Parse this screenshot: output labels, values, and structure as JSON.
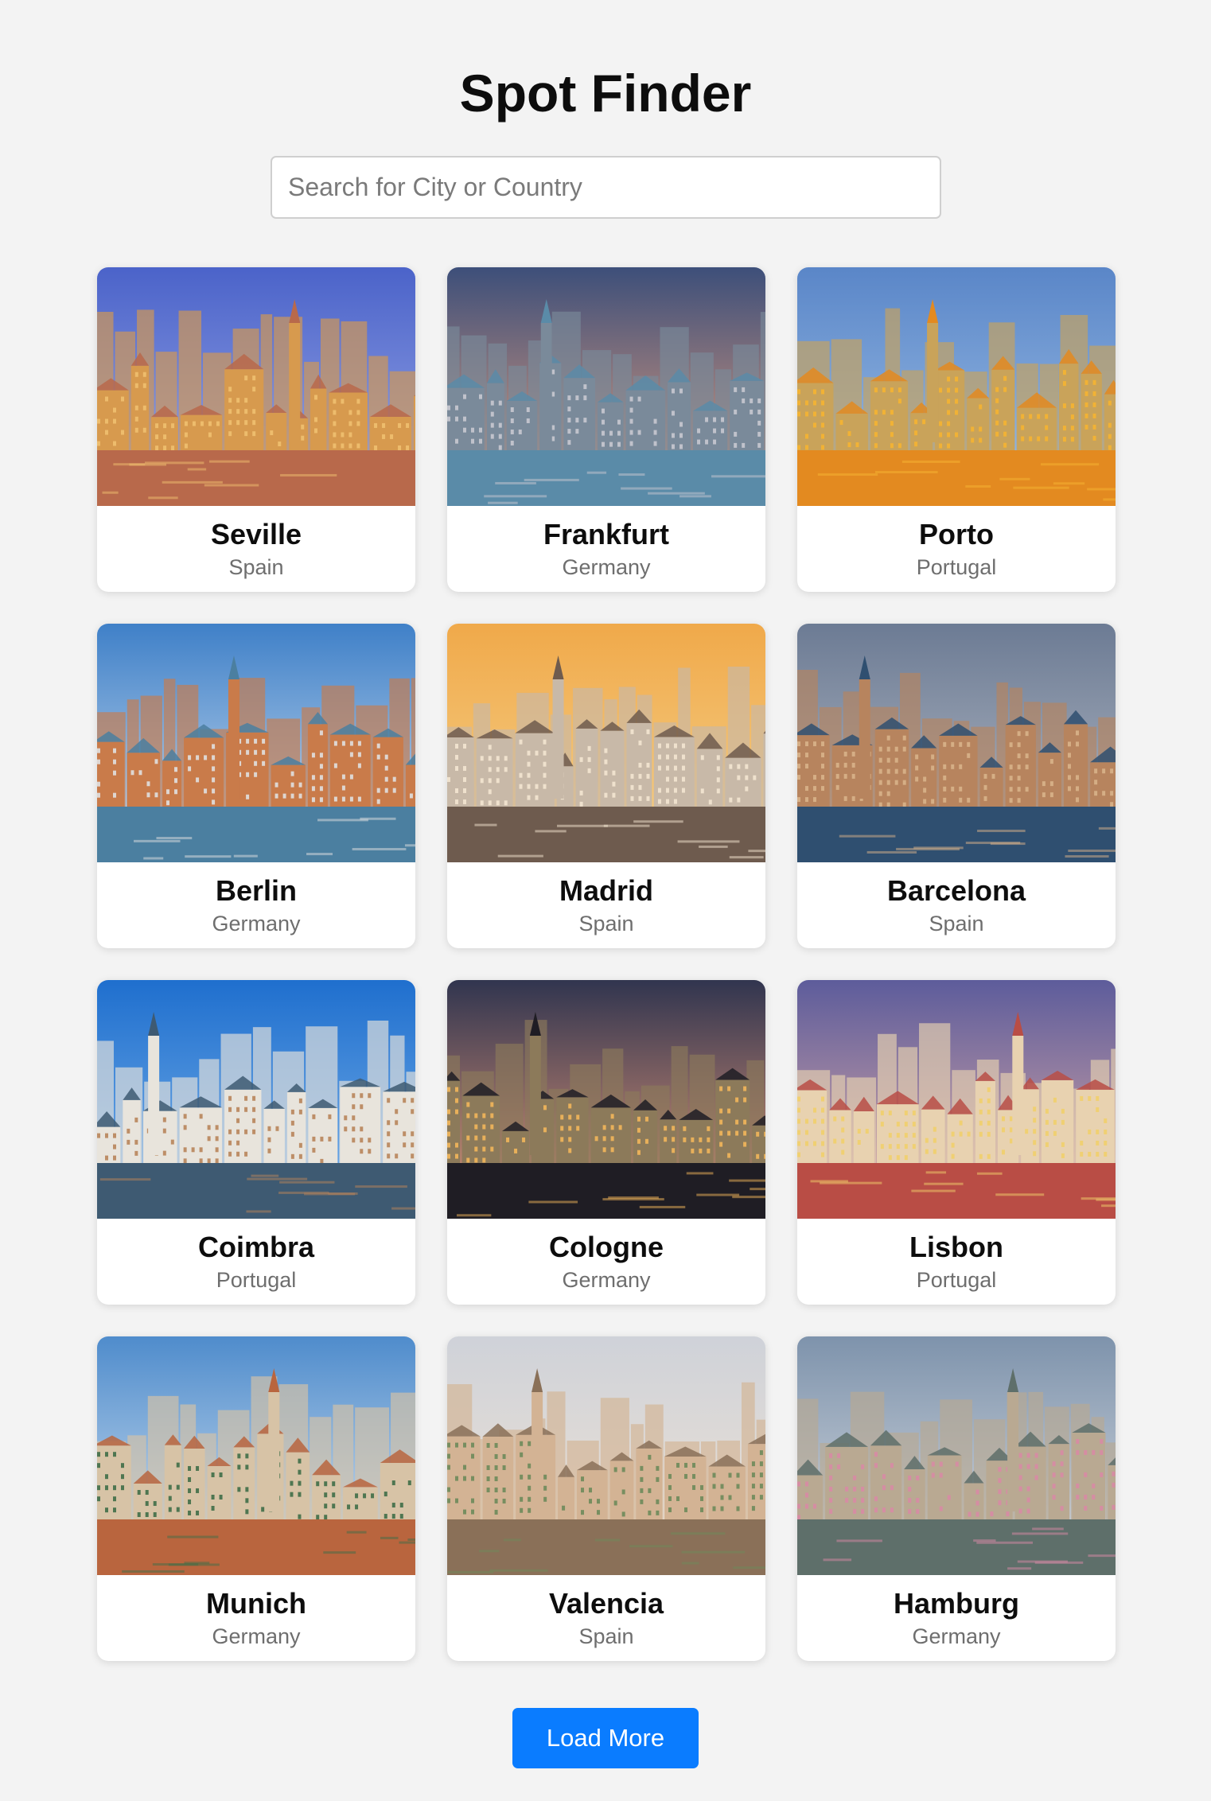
{
  "header": {
    "title": "Spot Finder"
  },
  "search": {
    "placeholder": "Search for City or Country",
    "value": ""
  },
  "cities": [
    {
      "name": "Seville",
      "country": "Spain",
      "palette": {
        "sky_top": "#4b63c9",
        "sky_bottom": "#9aa9e8",
        "ground": "#b8694b",
        "buildings": "#d79a4e",
        "accent": "#f0c070"
      }
    },
    {
      "name": "Frankfurt",
      "country": "Germany",
      "palette": {
        "sky_top": "#3d4f7a",
        "sky_bottom": "#e8a27e",
        "ground": "#5a8ba8",
        "buildings": "#7a8a9a",
        "accent": "#c8c8d0"
      }
    },
    {
      "name": "Porto",
      "country": "Portugal",
      "palette": {
        "sky_top": "#5a86c8",
        "sky_bottom": "#9ec0e6",
        "ground": "#e38a20",
        "buildings": "#c9a35a",
        "accent": "#f5b431"
      }
    },
    {
      "name": "Berlin",
      "country": "Germany",
      "palette": {
        "sky_top": "#3f80c8",
        "sky_bottom": "#cfe0f0",
        "ground": "#4b7fa0",
        "buildings": "#c97b4a",
        "accent": "#e0e0e0"
      }
    },
    {
      "name": "Madrid",
      "country": "Spain",
      "palette": {
        "sky_top": "#f0a94a",
        "sky_bottom": "#f6d28c",
        "ground": "#6e5b4e",
        "buildings": "#c8b9a8",
        "accent": "#f3e5d0"
      }
    },
    {
      "name": "Barcelona",
      "country": "Spain",
      "palette": {
        "sky_top": "#6c7b94",
        "sky_bottom": "#b6bcc6",
        "ground": "#2f4f70",
        "buildings": "#b7845e",
        "accent": "#d8b28a"
      }
    },
    {
      "name": "Coimbra",
      "country": "Portugal",
      "palette": {
        "sky_top": "#1f6fce",
        "sky_bottom": "#7bb3ea",
        "ground": "#3e5a72",
        "buildings": "#e8e4dc",
        "accent": "#b8845a"
      }
    },
    {
      "name": "Cologne",
      "country": "Germany",
      "palette": {
        "sky_top": "#31354f",
        "sky_bottom": "#e79a7a",
        "ground": "#1f1d24",
        "buildings": "#8c7a5a",
        "accent": "#f2b65a"
      }
    },
    {
      "name": "Lisbon",
      "country": "Portugal",
      "palette": {
        "sky_top": "#5d5c9b",
        "sky_bottom": "#e4b0a8",
        "ground": "#b94d45",
        "buildings": "#e8d2b0",
        "accent": "#f1cf6b"
      }
    },
    {
      "name": "Munich",
      "country": "Germany",
      "palette": {
        "sky_top": "#4f8ccc",
        "sky_bottom": "#d7e5f2",
        "ground": "#b9653e",
        "buildings": "#d7c3a6",
        "accent": "#3f6e48"
      }
    },
    {
      "name": "Valencia",
      "country": "Spain",
      "palette": {
        "sky_top": "#cfd2d9",
        "sky_bottom": "#efe3d4",
        "ground": "#8a7058",
        "buildings": "#d3b394",
        "accent": "#6d8a5a"
      }
    },
    {
      "name": "Hamburg",
      "country": "Germany",
      "palette": {
        "sky_top": "#7e93ac",
        "sky_bottom": "#d9dde2",
        "ground": "#5e6f6a",
        "buildings": "#b9a992",
        "accent": "#d88aa5"
      }
    }
  ],
  "actions": {
    "load_more_label": "Load More"
  }
}
